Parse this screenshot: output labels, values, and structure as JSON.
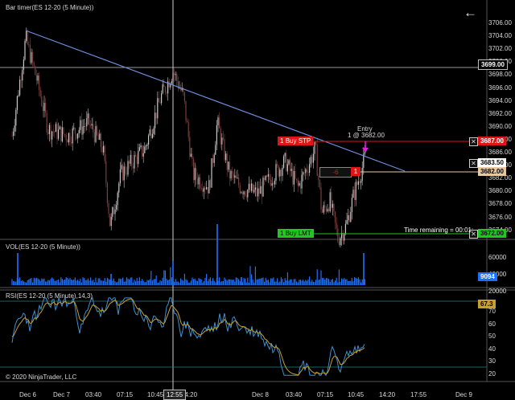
{
  "panels": {
    "price": {
      "title": "Bar timer(ES 12-20 (5 Minute))"
    },
    "volume": {
      "title": "VOL(ES 12-20 (5 Minute))"
    },
    "rsi": {
      "title": "RSI(ES 12-20 (5 Minute),14,3)"
    }
  },
  "copyright": "© 2020 NinjaTrader, LLC",
  "back_arrow": "←",
  "price_axis": [
    "3706.00",
    "3704.00",
    "3702.00",
    "3700.00",
    "3698.00",
    "3696.00",
    "3694.00",
    "3692.00",
    "3690.00",
    "3688.00",
    "3686.00",
    "3684.00",
    "3682.00",
    "3680.00",
    "3678.00",
    "3676.00",
    "3674.00"
  ],
  "volume_axis": [
    "60000",
    "40000",
    "20000"
  ],
  "rsi_axis": [
    "70",
    "60",
    "50",
    "40",
    "30",
    "20"
  ],
  "time_axis": [
    "Dec 6",
    "Dec 7",
    "03:40",
    "07:15",
    "10:45",
    "14:20",
    "Dec 8",
    "03:40",
    "07:15",
    "10:45",
    "14:20",
    "17:55",
    "Dec 9"
  ],
  "crosshair_time": "12:55",
  "markers": {
    "crosshair_price": "3699.00",
    "buy_stp_price": "3687.00",
    "last_price": "3683.50",
    "entry_price": "3682.00",
    "buy_lmt_price": "3672.00",
    "volume_value": "9094",
    "rsi_value": "67.3"
  },
  "orders": {
    "buy_stp": {
      "qty": "1",
      "label": "Buy STP"
    },
    "buy_lmt": {
      "qty": "1",
      "label": "Buy LMT"
    },
    "position_pnl": "-6",
    "position_qty": "1"
  },
  "entry_label": "Entry",
  "entry_detail": "1 @ 3682.00",
  "time_remaining": "Time remaining = 00:01:",
  "colors": {
    "background": "#000000",
    "candle_up": "#c8c8c8",
    "candle_down": "#7a4040",
    "trendline": "#6f8fe0",
    "buy_stp": "#e01616",
    "buy_lmt": "#1ec81e",
    "entry": "#e8c8a0",
    "volume": "#1f6fff",
    "rsi": "#3f8fd0",
    "rsi_avg": "#c8a030",
    "rsi_bands": "#2a8080",
    "entry_arrow": "#e020e0"
  }
}
